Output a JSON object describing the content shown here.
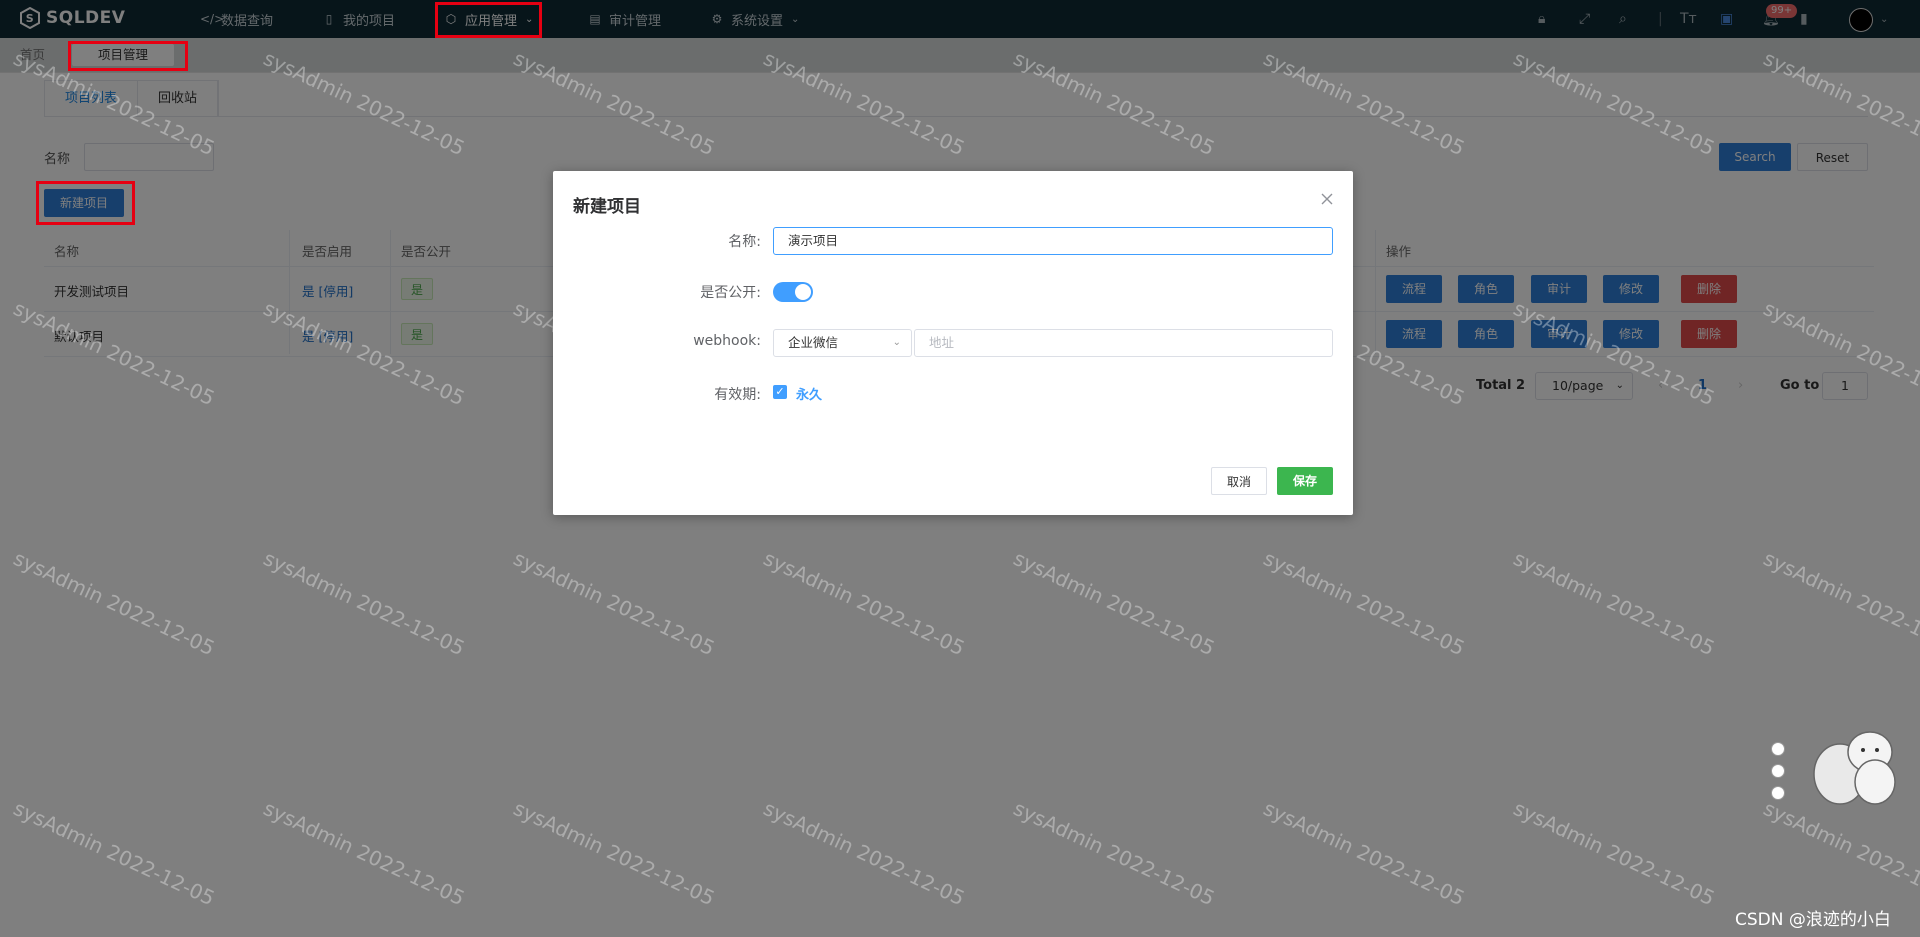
{
  "app": {
    "logo": "SQLDEV"
  },
  "nav": {
    "items": [
      {
        "label": "数据查询",
        "icon": "code-icon"
      },
      {
        "label": "我的项目",
        "icon": "book-icon"
      },
      {
        "label": "应用管理",
        "icon": "cube-icon"
      },
      {
        "label": "审计管理",
        "icon": "audit-icon"
      },
      {
        "label": "系统设置",
        "icon": "gear-icon"
      }
    ],
    "badge": "99+"
  },
  "tags": {
    "home": "首页",
    "current": "项目管理"
  },
  "subtabs": {
    "list": "项目列表",
    "recycle": "回收站"
  },
  "search": {
    "label": "名称",
    "search_btn": "Search",
    "reset_btn": "Reset"
  },
  "actions": {
    "new_project": "新建项目"
  },
  "table": {
    "headers": {
      "name": "名称",
      "enabled": "是否启用",
      "public": "是否公开",
      "ops": "操作"
    },
    "rows": [
      {
        "name": "开发测试项目",
        "enabled": "是 [停用]",
        "public": "是"
      },
      {
        "name": "默认项目",
        "enabled": "是 [停用]",
        "public": "是"
      }
    ],
    "row_buttons": {
      "flow": "流程",
      "role": "角色",
      "audit": "审计",
      "edit": "修改",
      "delete": "删除"
    }
  },
  "pager": {
    "total": "Total 2",
    "page_size": "10/page",
    "current": "1",
    "goto_label": "Go to",
    "goto_value": "1"
  },
  "watermark": "sysAdmin 2022-12-05",
  "dialog": {
    "title": "新建项目",
    "name_label": "名称:",
    "name_value": "演示项目",
    "public_label": "是否公开:",
    "webhook_label": "webhook:",
    "webhook_type": "企业微信",
    "webhook_placeholder": "地址",
    "validity_label": "有效期:",
    "validity_value": "永久",
    "cancel": "取消",
    "save": "保存"
  },
  "footer_mark": "CSDN @浪迹的小白",
  "colors": {
    "navbar": "#0e2a35",
    "primary": "#2f7fd8",
    "danger": "#e04a4a",
    "success": "#3cb64f",
    "highlight": "#e60012"
  }
}
